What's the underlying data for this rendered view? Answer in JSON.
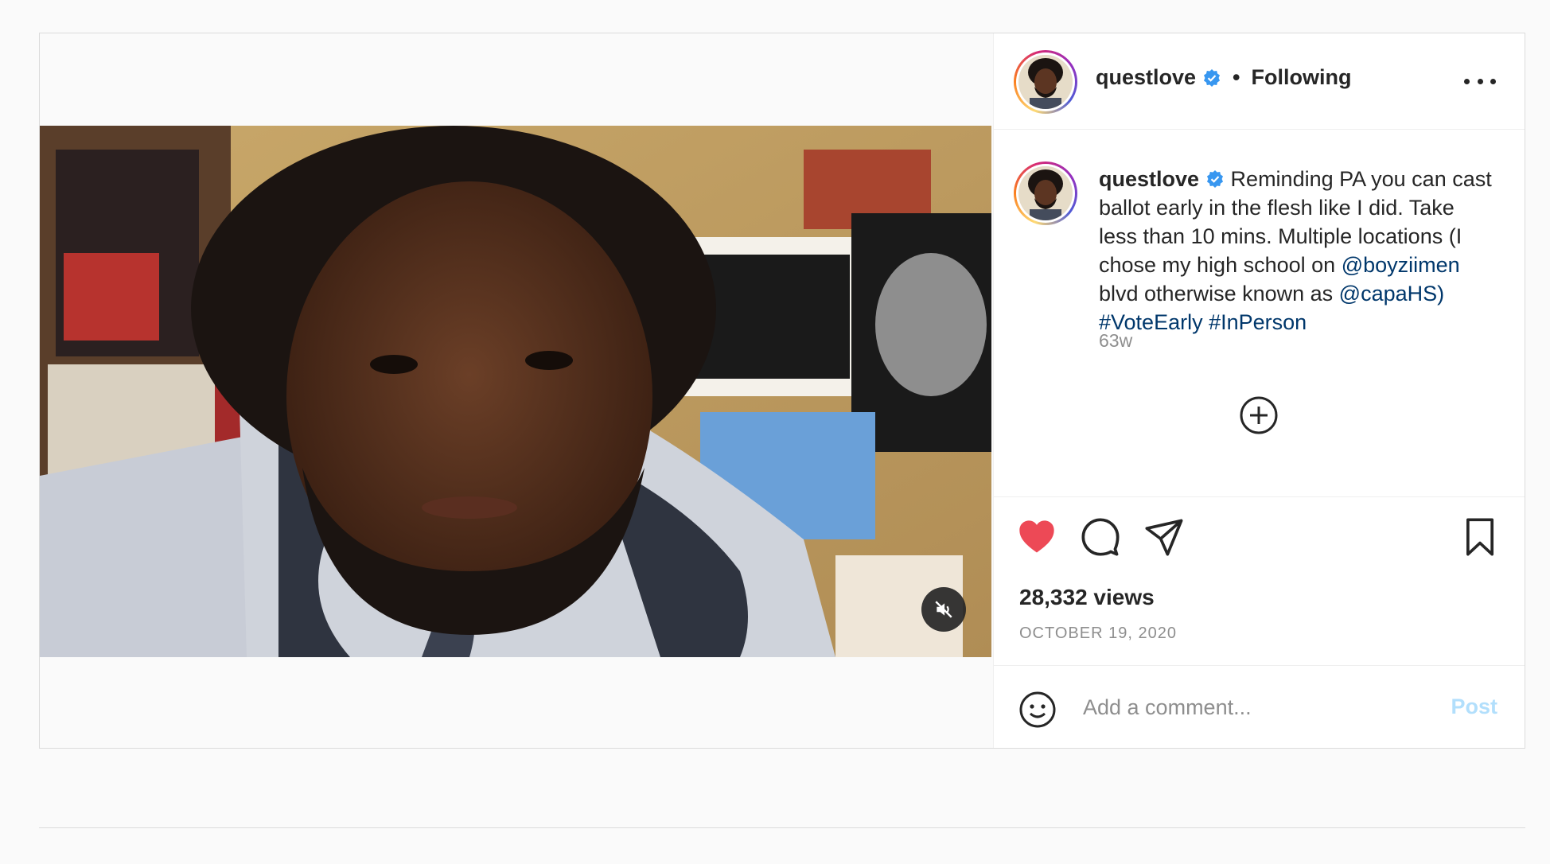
{
  "post": {
    "username": "questlove",
    "verified": true,
    "follow_status": "Following",
    "separator": "•",
    "caption_text_1": " Reminding PA you can cast ballot early in the flesh like I did. Take less than 10 mins. Multiple locations (I chose my high school on ",
    "mention_1": "@boyziimen",
    "caption_text_2": " blvd otherwise known as ",
    "mention_2": "@capaHS)",
    "caption_text_3": " ",
    "hashtag_1": "#VoteEarly",
    "caption_text_4": " ",
    "hashtag_2": "#InPerson",
    "age": "63w",
    "views": "28,332 views",
    "date": "OCTOBER 19, 2020",
    "liked": true
  },
  "comment": {
    "placeholder": "Add a comment...",
    "post_label": "Post"
  },
  "colors": {
    "like": "#ed4956",
    "link": "#00376b",
    "post_button_disabled": "#b2dffc",
    "verified": "#3897f0"
  },
  "icons": {
    "more": "more-options-icon",
    "heart": "heart-icon",
    "comment": "comment-icon",
    "share": "share-icon",
    "save": "bookmark-icon",
    "emoji": "emoji-icon",
    "mute": "muted-speaker-icon",
    "load_more": "plus-circle-icon"
  }
}
